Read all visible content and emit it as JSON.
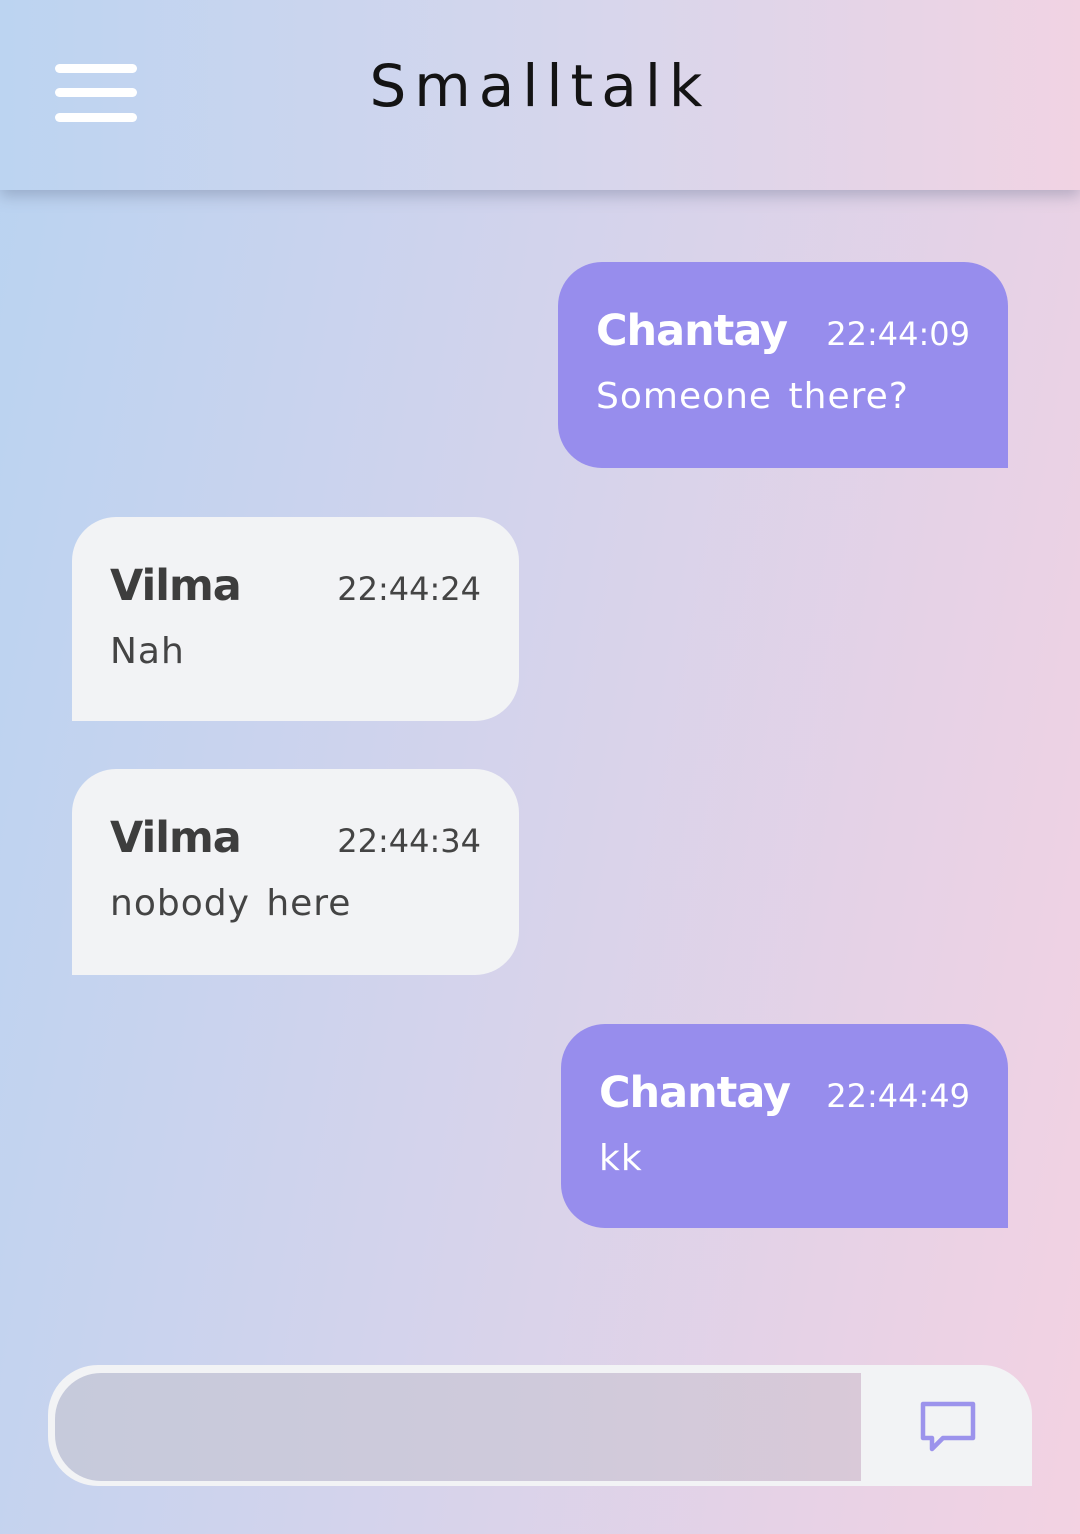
{
  "header": {
    "title": "Smalltalk",
    "menu_icon": "hamburger-menu-icon"
  },
  "messages": [
    {
      "direction": "sent",
      "sender": "Chantay",
      "time": "22:44:09",
      "text": "Someone there?"
    },
    {
      "direction": "received",
      "sender": "Vilma",
      "time": "22:44:24",
      "text": "Nah"
    },
    {
      "direction": "received",
      "sender": "Vilma",
      "time": "22:44:34",
      "text": "nobody here"
    },
    {
      "direction": "sent",
      "sender": "Chantay",
      "time": "22:44:49",
      "text": "kk"
    }
  ],
  "composer": {
    "value": "",
    "placeholder": "",
    "send_icon": "chat-bubble-icon"
  },
  "colors": {
    "sent_bubble": "#978ded",
    "received_bubble": "#f2f3f5",
    "send_icon": "#9c93ec"
  }
}
